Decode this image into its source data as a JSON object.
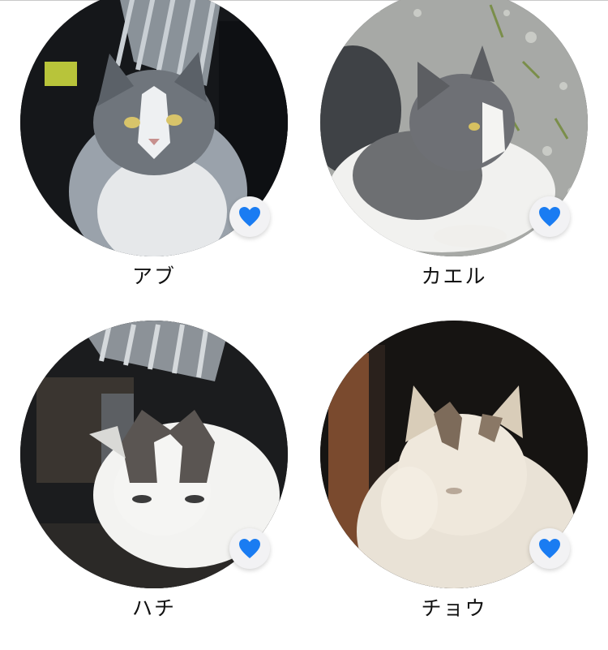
{
  "accent_color": "#1a7cf2",
  "favorite_icon": "heart-icon",
  "cats": [
    {
      "name": "アブ",
      "favorited": true
    },
    {
      "name": "カエル",
      "favorited": true
    },
    {
      "name": "ハチ",
      "favorited": true
    },
    {
      "name": "チョウ",
      "favorited": true
    }
  ]
}
